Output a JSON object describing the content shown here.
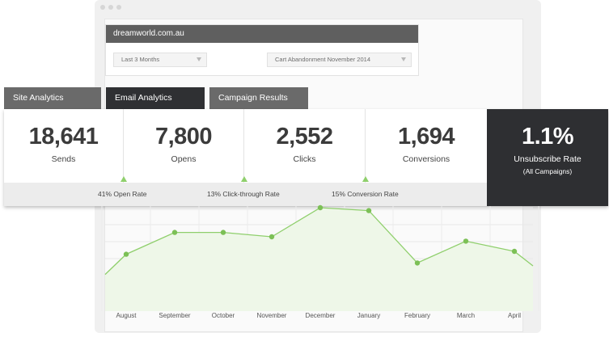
{
  "site": {
    "title": "dreamworld.com.au",
    "filters": [
      {
        "label": "Last 3 Months",
        "icon": "funnel-icon"
      },
      {
        "label": "Cart Abandonment November 2014",
        "icon": "funnel-icon"
      }
    ]
  },
  "tabs": [
    {
      "label": "Site Analytics",
      "active": false
    },
    {
      "label": "Email Analytics",
      "active": true
    },
    {
      "label": "Campaign Results",
      "active": false
    }
  ],
  "stats": [
    {
      "value": "18,641",
      "label": "Sends"
    },
    {
      "value": "7,800",
      "label": "Opens"
    },
    {
      "value": "2,552",
      "label": "Clicks"
    },
    {
      "value": "1,694",
      "label": "Conversions"
    }
  ],
  "highlight": {
    "value": "1.1%",
    "label": "Unsubscribe Rate",
    "sub": "(All Campaigns)"
  },
  "rates": [
    "41% Open Rate",
    "13% Click-through Rate",
    "15% Conversion Rate"
  ],
  "colors": {
    "accent": "#8fcf6c",
    "dark": "#2e2f32",
    "tab_inactive": "#6a6a6a"
  },
  "chart_data": {
    "type": "area",
    "categories": [
      "August",
      "September",
      "October",
      "November",
      "December",
      "January",
      "February",
      "March",
      "April"
    ],
    "values": [
      0.68,
      0.83,
      0.83,
      0.8,
      1.0,
      0.98,
      0.62,
      0.77,
      0.7
    ],
    "ylim": [
      0.3,
      1.0
    ],
    "grid": true
  }
}
